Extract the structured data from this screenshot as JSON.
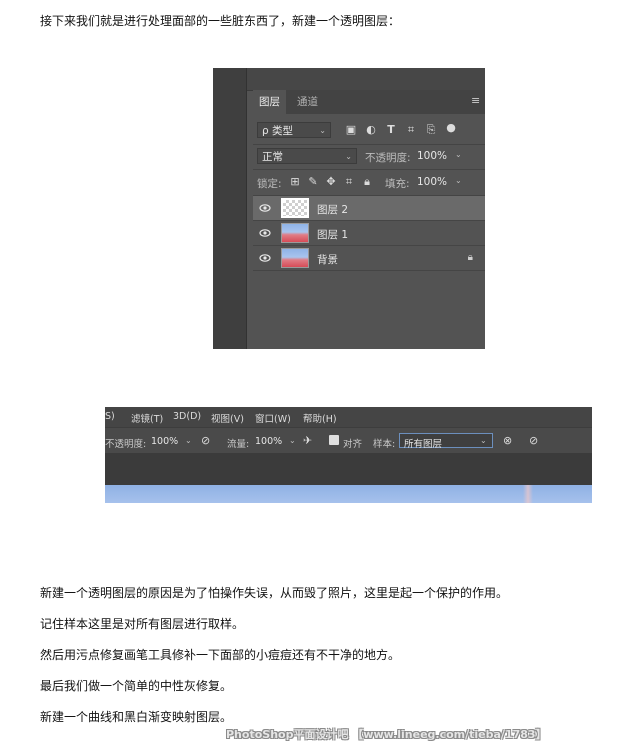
{
  "intro": "接下来我们就是进行处理面部的一些脏东西了，新建一个透明图层：",
  "layers_panel": {
    "tabs": [
      "图层",
      "通道"
    ],
    "filter_label": "ρ 类型",
    "blend_mode": "正常",
    "opacity_label": "不透明度:",
    "opacity_value": "100%",
    "lock_label": "锁定:",
    "fill_label": "填充:",
    "fill_value": "100%",
    "layers": [
      {
        "name": "图层 2",
        "thumb": "transparent",
        "selected": true
      },
      {
        "name": "图层 1",
        "thumb": "photo",
        "selected": false
      },
      {
        "name": "背景",
        "thumb": "photo",
        "selected": false,
        "locked": true
      }
    ]
  },
  "toolbar": {
    "menu": [
      "S)",
      "滤镜(T)",
      "3D(D)",
      "视图(V)",
      "窗口(W)",
      "帮助(H)"
    ],
    "opacity_label": "不透明度:",
    "opacity_value": "100%",
    "flow_label": "流量:",
    "flow_value": "100%",
    "align_label": "对齐",
    "sample_label": "样本:",
    "sample_value": "所有图层"
  },
  "paragraphs": [
    "新建一个透明图层的原因是为了怕操作失误，从而毁了照片，这里是起一个保护的作用。",
    "记住样本这里是对所有图层进行取样。",
    "然后用污点修复画笔工具修补一下面部的小痘痘还有不干净的地方。",
    "最后我们做一个简单的中性灰修复。",
    "新建一个曲线和黑白渐变映射图层。"
  ],
  "watermark": "PhotoShop平面设计吧 【www.lineeg.com/tieba/1783】",
  "colors": {
    "panel_bg": "#535353",
    "selected_layer": "#6a6a6a",
    "sample_border": "#6c8fbd"
  }
}
